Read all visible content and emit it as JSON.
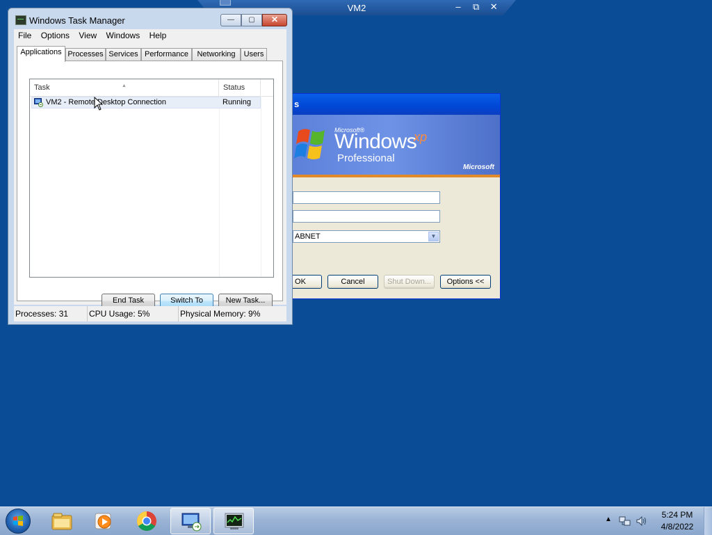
{
  "rdp_bar": {
    "title": "VM2",
    "minimize": "–",
    "restore": "⧉",
    "close": "✕"
  },
  "xp_logon": {
    "title_fragment": "s",
    "logo": {
      "microsoft_small": "Microsoft®",
      "windows": "Windows",
      "xp": "xp",
      "edition": "Professional",
      "microsoft": "Microsoft"
    },
    "username_value": "",
    "password_value": "",
    "domain_value": "ABNET",
    "buttons": {
      "ok": "OK",
      "cancel": "Cancel",
      "shutdown": "Shut Down...",
      "options": "Options <<"
    }
  },
  "task_manager": {
    "title": "Windows Task Manager",
    "window_controls": {
      "minimize": "—",
      "maximize": "▢",
      "close": "✕"
    },
    "menu": [
      "File",
      "Options",
      "View",
      "Windows",
      "Help"
    ],
    "tabs": [
      "Applications",
      "Processes",
      "Services",
      "Performance",
      "Networking",
      "Users"
    ],
    "active_tab": "Applications",
    "columns": {
      "task": "Task",
      "status": "Status"
    },
    "tasks": [
      {
        "name": "VM2 - Remote Desktop Connection",
        "status": "Running"
      }
    ],
    "buttons": {
      "end_task": "End Task",
      "switch_to": "Switch To",
      "new_task": "New Task..."
    },
    "status_bar": {
      "processes": "Processes: 31",
      "cpu": "CPU Usage: 5%",
      "memory": "Physical Memory: 9%"
    }
  },
  "taskbar": {
    "pinned": [
      "file-explorer-icon",
      "media-player-icon",
      "chrome-icon",
      "remote-desktop-icon",
      "task-manager-icon"
    ],
    "tray_icons": [
      "show-hidden-icons-arrow",
      "network-icon",
      "volume-icon"
    ],
    "clock": {
      "time": "5:24 PM",
      "date": "4/8/2022"
    }
  },
  "colors": {
    "desktop": "#0a4d96",
    "xp_banner": "#6e93e6",
    "xp_accent_orange": "#e08a2c"
  }
}
